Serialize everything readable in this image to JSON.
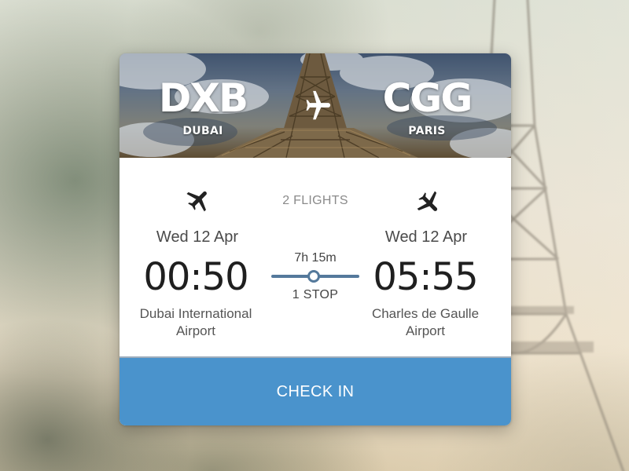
{
  "route": {
    "origin": {
      "code": "DXB",
      "city": "DUBAI"
    },
    "destination": {
      "code": "CGG",
      "city": "PARIS"
    }
  },
  "itinerary": {
    "flights_count": "2 FLIGHTS",
    "duration": "7h 15m",
    "stops": "1 STOP",
    "departure": {
      "date": "Wed 12 Apr",
      "time": "00:50",
      "airport_line1": "Dubai International",
      "airport_line2": "Airport",
      "icon": "plane-takeoff-icon"
    },
    "arrival": {
      "date": "Wed 12 Apr",
      "time": "05:55",
      "airport_line1": "Charles de Gaulle",
      "airport_line2": "Airport",
      "icon": "plane-landing-icon"
    }
  },
  "actions": {
    "checkin_label": "CHECK IN"
  },
  "colors": {
    "accent": "#4a93cc",
    "route_line": "#54799b",
    "text_dark": "#1f1f1f",
    "text_muted": "#8a8a8a"
  }
}
